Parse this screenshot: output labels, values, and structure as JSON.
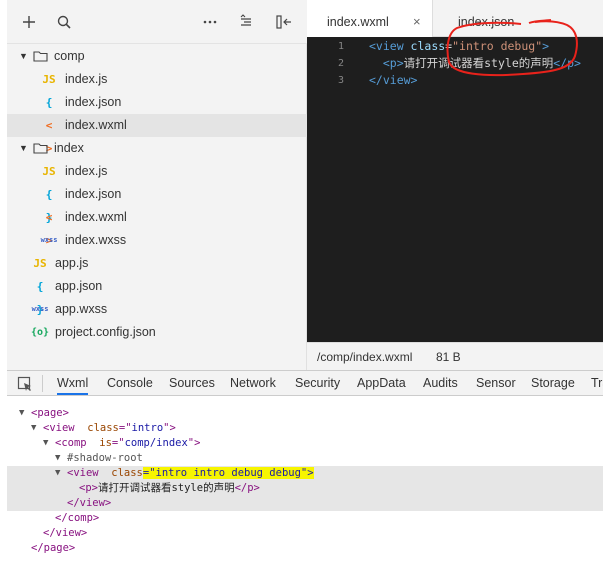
{
  "explorer": {
    "toolbar": {
      "add_icon": "plus-icon",
      "search_icon": "search-icon",
      "more_icon": "ellipsis-icon",
      "sort_icon": "sort-icon",
      "collapse_icon": "collapse-icon"
    },
    "tree": [
      {
        "type": "folder",
        "label": "comp",
        "expanded": true,
        "depth": 0
      },
      {
        "type": "file",
        "label": "index.js",
        "icon": "JS",
        "kind": "js",
        "depth": 1
      },
      {
        "type": "file",
        "label": "index.json",
        "icon": "{ }",
        "kind": "json",
        "depth": 1
      },
      {
        "type": "file",
        "label": "index.wxml",
        "icon": "< >",
        "kind": "wxml",
        "depth": 1,
        "selected": true
      },
      {
        "type": "folder",
        "label": "index",
        "expanded": true,
        "depth": 0
      },
      {
        "type": "file",
        "label": "index.js",
        "icon": "JS",
        "kind": "js",
        "depth": 1
      },
      {
        "type": "file",
        "label": "index.json",
        "icon": "{ }",
        "kind": "json",
        "depth": 1
      },
      {
        "type": "file",
        "label": "index.wxml",
        "icon": "< >",
        "kind": "wxml",
        "depth": 1
      },
      {
        "type": "file",
        "label": "index.wxss",
        "icon": "wxss",
        "kind": "wxss",
        "depth": 1
      },
      {
        "type": "file",
        "label": "app.js",
        "icon": "JS",
        "kind": "js",
        "depth": 0
      },
      {
        "type": "file",
        "label": "app.json",
        "icon": "{ }",
        "kind": "json",
        "depth": 0
      },
      {
        "type": "file",
        "label": "app.wxss",
        "icon": "wxss",
        "kind": "wxss",
        "depth": 0
      },
      {
        "type": "file",
        "label": "project.config.json",
        "icon": "{o}",
        "kind": "cfg",
        "depth": 0
      }
    ]
  },
  "editor": {
    "tabs": [
      {
        "label": "index.wxml",
        "active": true,
        "close": "×"
      },
      {
        "label": "index.json",
        "active": false
      }
    ],
    "lines": [
      {
        "num": "1",
        "parts": [
          {
            "t": "<view ",
            "c": "tag"
          },
          {
            "t": "class",
            "c": "attr"
          },
          {
            "t": "=",
            "c": "eq"
          },
          {
            "t": "\"intro debug\"",
            "c": "str"
          },
          {
            "t": ">",
            "c": "tag"
          }
        ]
      },
      {
        "num": "2",
        "parts": [
          {
            "t": "  <p>",
            "c": "tag"
          },
          {
            "t": "请打开调试器看style的声明",
            "c": "txt"
          },
          {
            "t": "</p>",
            "c": "tag"
          }
        ]
      },
      {
        "num": "3",
        "parts": [
          {
            "t": "</view>",
            "c": "tag"
          }
        ]
      }
    ],
    "status": {
      "path": "/comp/index.wxml",
      "size": "81 B"
    }
  },
  "devtools": {
    "tabs": [
      "Wxml",
      "Console",
      "Sources",
      "Network",
      "Security",
      "AppData",
      "Audits",
      "Sensor",
      "Storage",
      "Trace"
    ],
    "active_tab": "Wxml",
    "inspect_icon": "inspect-element-icon"
  },
  "dom_tree": [
    {
      "tri": "▼",
      "parts": [
        {
          "t": "<page>",
          "c": "tag"
        }
      ]
    },
    {
      "tri": "▼",
      "parts": [
        {
          "t": "<view ",
          "c": "tag"
        },
        {
          "t": " class",
          "c": "attr"
        },
        {
          "t": "=\"",
          "c": "tag"
        },
        {
          "t": "intro",
          "c": "val"
        },
        {
          "t": "\">",
          "c": "tag"
        }
      ]
    },
    {
      "tri": "▼",
      "parts": [
        {
          "t": "<comp ",
          "c": "tag"
        },
        {
          "t": " is",
          "c": "attr"
        },
        {
          "t": "=\"",
          "c": "tag"
        },
        {
          "t": "comp/index",
          "c": "val"
        },
        {
          "t": "\">",
          "c": "tag"
        }
      ]
    },
    {
      "tri": "▼",
      "parts": [
        {
          "t": "#shadow-root",
          "c": "shadow"
        }
      ]
    },
    {
      "tri": "▼",
      "hl": true,
      "parts": [
        {
          "t": "<view ",
          "c": "tag"
        },
        {
          "t": " class",
          "c": "attr"
        },
        {
          "t": "=\"intro intro debug debug\">",
          "c": "mark"
        }
      ]
    },
    {
      "tri": "",
      "hl": true,
      "parts": [
        {
          "t": "<p>",
          "c": "tag"
        },
        {
          "t": "请打开调试器看style的声明",
          "c": "txt"
        },
        {
          "t": "</p>",
          "c": "tag"
        }
      ]
    },
    {
      "tri": "",
      "hl": true,
      "parts": [
        {
          "t": "</view>",
          "c": "tag"
        }
      ]
    },
    {
      "tri": "",
      "parts": [
        {
          "t": "</comp>",
          "c": "tag"
        }
      ]
    },
    {
      "tri": "",
      "parts": [
        {
          "t": "</view>",
          "c": "tag"
        }
      ]
    },
    {
      "tri": "",
      "parts": [
        {
          "t": "</page>",
          "c": "tag"
        }
      ]
    }
  ],
  "colors": {
    "annotation_red": "#e8221b",
    "highlight_yellow": "#f7f500",
    "editor_bg": "#1e1e1e"
  }
}
